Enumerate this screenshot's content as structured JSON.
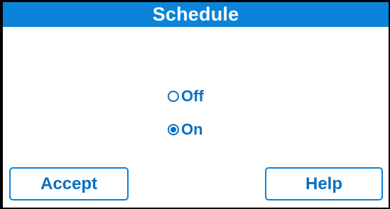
{
  "title": "Schedule",
  "options": [
    {
      "label": "Off",
      "selected": false
    },
    {
      "label": "On",
      "selected": true
    }
  ],
  "buttons": {
    "accept_label": "Accept",
    "help_label": "Help"
  },
  "colors": {
    "title_bar": "#0a83d8",
    "accent": "#0a6fc0",
    "background": "#ffffff",
    "frame": "#000000"
  }
}
